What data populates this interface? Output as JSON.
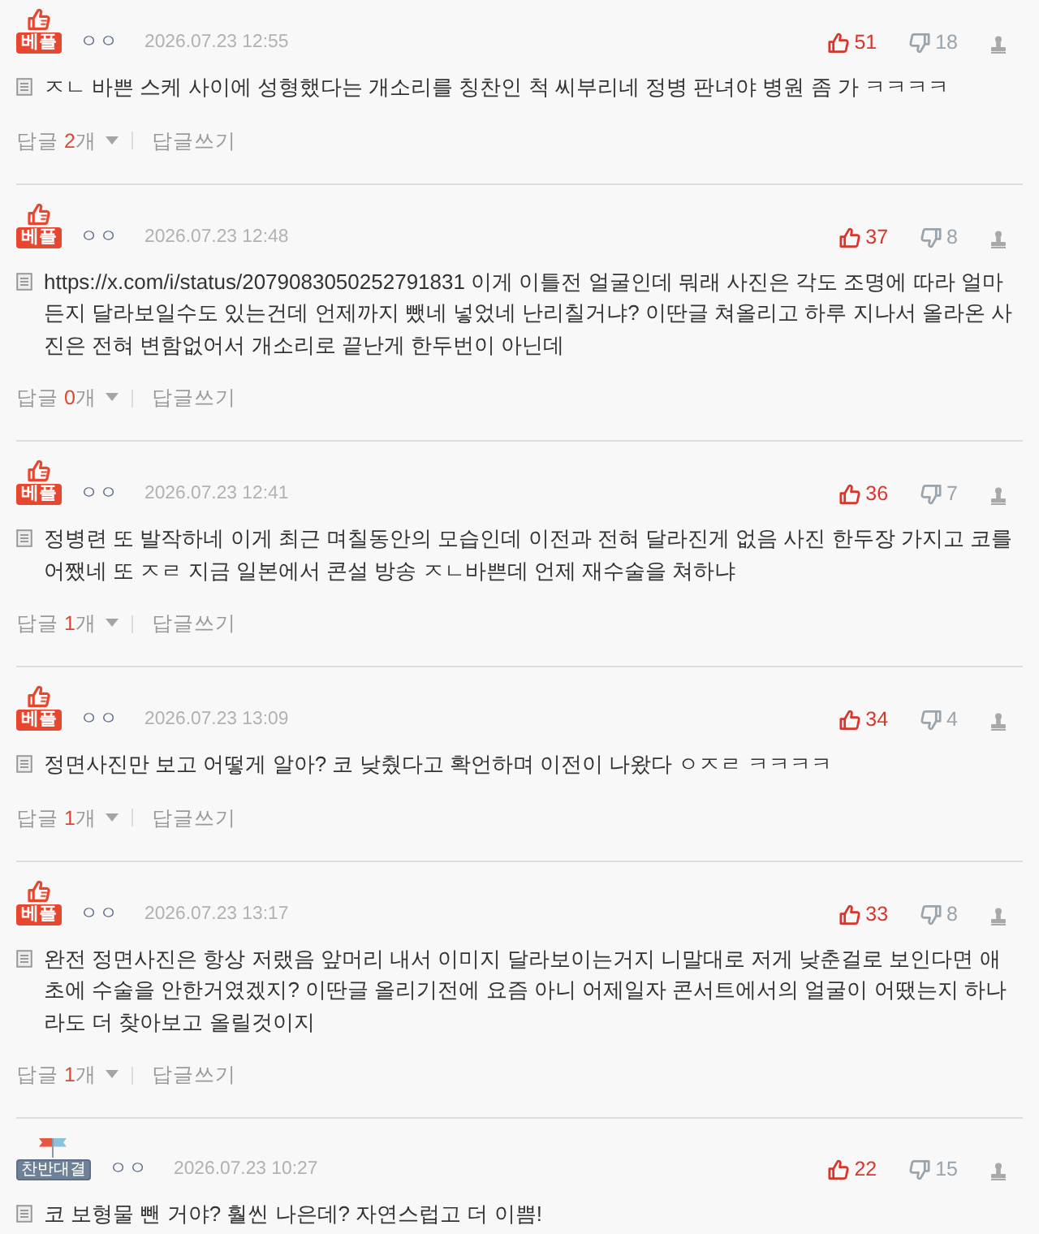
{
  "comments": [
    {
      "badge": {
        "kind": "best",
        "label": "베플"
      },
      "author": "ㅇㅇ",
      "date": "2026.07.23 12:55",
      "upvotes": "51",
      "downvotes": "18",
      "text": "ㅈㄴ 바쁜 스케 사이에 성형했다는 개소리를 칭찬인 척 씨부리네 정병 판녀야 병원 좀 가 ㅋㅋㅋㅋ",
      "replies": {
        "label": "답글",
        "count": "2",
        "unit": "개"
      },
      "write_reply": "답글쓰기"
    },
    {
      "badge": {
        "kind": "best",
        "label": "베플"
      },
      "author": "ㅇㅇ",
      "date": "2026.07.23 12:48",
      "upvotes": "37",
      "downvotes": "8",
      "text": "https://x.com/i/status/2079083050252791831 이게 이틀전 얼굴인데 뭐래 사진은 각도 조명에 따라 얼마든지 달라보일수도 있는건데 언제까지 뺐네 넣었네 난리칠거냐? 이딴글 쳐올리고 하루 지나서 올라온 사진은 전혀 변함없어서 개소리로 끝난게 한두번이 아닌데",
      "replies": {
        "label": "답글",
        "count": "0",
        "unit": "개"
      },
      "write_reply": "답글쓰기"
    },
    {
      "badge": {
        "kind": "best",
        "label": "베플"
      },
      "author": "ㅇㅇ",
      "date": "2026.07.23 12:41",
      "upvotes": "36",
      "downvotes": "7",
      "text": "정병련 또 발작하네 이게 최근 며칠동안의 모습인데 이전과 전혀 달라진게 없음 사진 한두장 가지고 코를 어쨌네 또 ㅈㄹ 지금 일본에서 콘설 방송 ㅈㄴ바쁜데 언제 재수술을 쳐하냐",
      "replies": {
        "label": "답글",
        "count": "1",
        "unit": "개"
      },
      "write_reply": "답글쓰기"
    },
    {
      "badge": {
        "kind": "best",
        "label": "베플"
      },
      "author": "ㅇㅇ",
      "date": "2026.07.23 13:09",
      "upvotes": "34",
      "downvotes": "4",
      "text": "정면사진만 보고 어떻게 알아? 코 낮췄다고 확언하며 이전이 나왔다 ㅇㅈㄹ ㅋㅋㅋㅋ",
      "replies": {
        "label": "답글",
        "count": "1",
        "unit": "개"
      },
      "write_reply": "답글쓰기"
    },
    {
      "badge": {
        "kind": "best",
        "label": "베플"
      },
      "author": "ㅇㅇ",
      "date": "2026.07.23 13:17",
      "upvotes": "33",
      "downvotes": "8",
      "text": "완전 정면사진은 항상 저랬음 앞머리 내서 이미지 달라보이는거지 니말대로 저게 낮춘걸로 보인다면 애초에 수술을 안한거였겠지? 이딴글 올리기전에 요즘 아니 어제일자 콘서트에서의 얼굴이 어땠는지 하나라도 더 찾아보고 올릴것이지",
      "replies": {
        "label": "답글",
        "count": "1",
        "unit": "개"
      },
      "write_reply": "답글쓰기"
    },
    {
      "badge": {
        "kind": "versus",
        "label": "찬반대결"
      },
      "author": "ㅇㅇ",
      "date": "2026.07.23 10:27",
      "upvotes": "22",
      "downvotes": "15",
      "text": "코 보형물 뺀 거야? 훨씬 나은데? 자연스럽고 더 이쁨!"
    }
  ]
}
